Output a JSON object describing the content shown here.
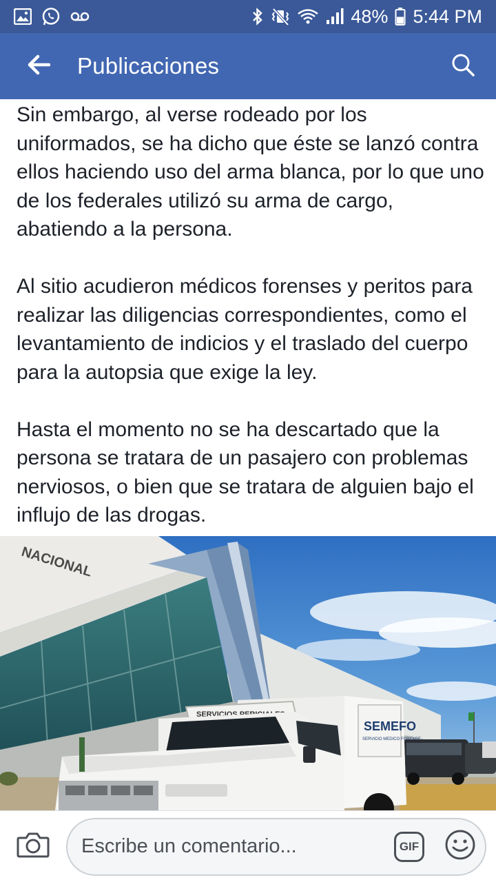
{
  "status_bar": {
    "battery_percent": "48%",
    "time": "5:44 PM",
    "icons": [
      "gallery-icon",
      "whatsapp-icon",
      "voicemail-icon",
      "bluetooth-icon",
      "vibrate-mute-icon",
      "wifi-icon",
      "signal-icon",
      "battery-icon"
    ]
  },
  "app_bar": {
    "title": "Publicaciones",
    "back_icon": "arrow-left-icon",
    "search_icon": "search-icon"
  },
  "post": {
    "paragraphs": [
      "Sin embargo, al verse rodeado por los uniformados, se ha dicho que éste se lanzó contra ellos haciendo uso del arma blanca, por lo que uno de los federales utilizó su arma de cargo, abatiendo a la persona.",
      "Al sitio acudieron médicos forenses y peritos para realizar las diligencias correspondientes, como el levantamiento de indicios y el traslado del cuerpo para la autopsia que exige la ley.",
      "Hasta el momento no se ha descartado que la persona se tratara de un pasajero con problemas nerviosos, o bien que se tratara de alguien bajo el influjo de las drogas."
    ],
    "photo": {
      "building_sign": "NACIONAL",
      "truck_label": "SEMEFO",
      "truck_sublabel": "SERVICIO MEDICO FORENSE",
      "truck_roof_label": "SERVICIOS PERICIALES"
    }
  },
  "comment_bar": {
    "placeholder": "Escribe un comentario...",
    "gif_label": "GIF",
    "camera_icon": "camera-icon",
    "emoji_icon": "emoji-icon"
  },
  "colors": {
    "status_bar": "#3b5998",
    "app_bar": "#4267b2",
    "text": "#1d2129"
  }
}
